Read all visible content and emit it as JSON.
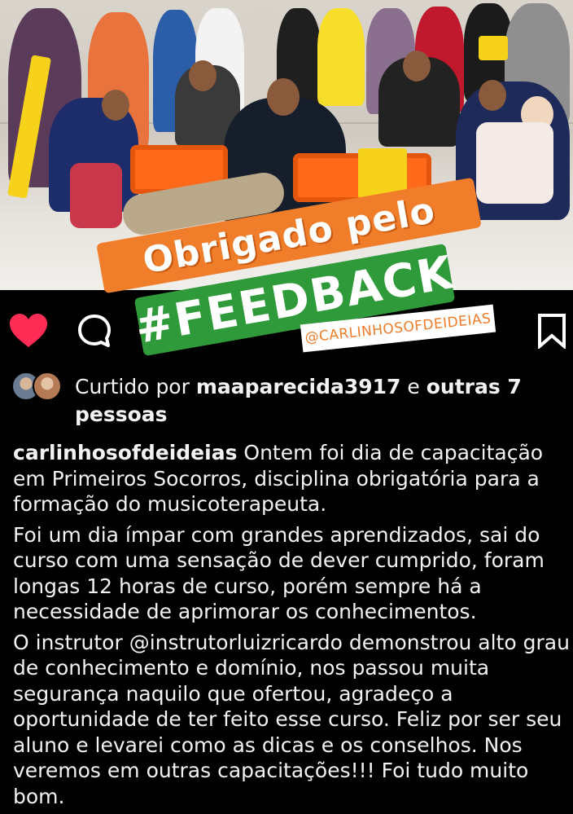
{
  "photo": {
    "overlay_line1": "Obrigado pelo",
    "overlay_line2": "#FEEDBACK",
    "handle_sticker": "@CARLINHOSOFDEIDEIAS"
  },
  "actions": {
    "like_icon": "heart-filled-icon",
    "comment_icon": "comment-icon",
    "save_icon": "bookmark-icon",
    "like_color": "#ff2d55"
  },
  "likes": {
    "prefix": "Curtido por",
    "user": "maaparecida3917",
    "conjunction": "e",
    "others": "outras 7 pessoas"
  },
  "caption": {
    "author": "carlinhosofdeideias",
    "p1": "Ontem foi dia de capacitação em Primeiros Socorros, disciplina obrigatória para a formação do musicoterapeuta.",
    "p2": "Foi um dia ímpar com grandes aprendizados, sai do curso com uma sensação de dever cumprido, foram longas 12 horas de curso, porém sempre há a necessidade de aprimorar os conhecimentos.",
    "p3": "O instrutor @instrutorluizricardo demonstrou alto grau de conhecimento e domínio, nos passou muita segurança naquilo que ofertou, agradeço a oportunidade de ter feito esse curso. Feliz por ser seu aluno e levarei como as dicas e os conselhos. Nos veremos em outras capacitações!!! Foi tudo muito bom."
  }
}
